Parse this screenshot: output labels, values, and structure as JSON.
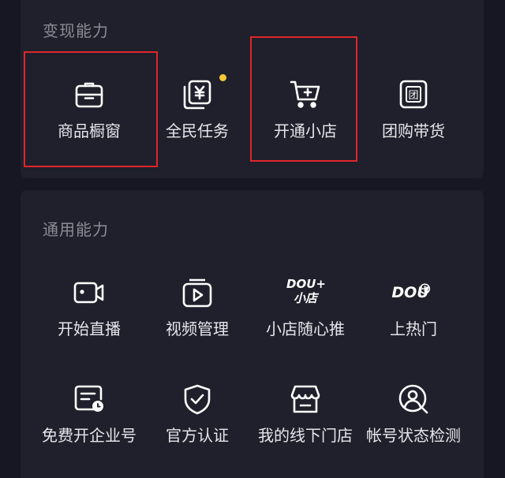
{
  "sections": {
    "monetize": {
      "title": "变现能力",
      "items": [
        {
          "label": "商品橱窗",
          "icon": "briefcase-icon"
        },
        {
          "label": "全民任务",
          "icon": "yen-cards-icon"
        },
        {
          "label": "开通小店",
          "icon": "shopping-cart-icon"
        },
        {
          "label": "团购带货",
          "icon": "group-buy-icon",
          "badge_text": "团"
        }
      ]
    },
    "general": {
      "title": "通用能力",
      "items": [
        {
          "label": "开始直播",
          "icon": "live-camera-icon"
        },
        {
          "label": "视频管理",
          "icon": "video-manage-icon"
        },
        {
          "label": "小店随心推",
          "icon": "dou-plus-shop-logo-icon",
          "logo_line1": "DOU+",
          "logo_line2": "小店"
        },
        {
          "label": "上热门",
          "icon": "dou-plus-logo-icon",
          "logo_text": "DOU"
        },
        {
          "label": "免费开企业号",
          "icon": "enterprise-card-icon"
        },
        {
          "label": "官方认证",
          "icon": "shield-check-icon"
        },
        {
          "label": "我的线下门店",
          "icon": "storefront-icon"
        },
        {
          "label": "帐号状态检测",
          "icon": "account-check-icon"
        }
      ]
    }
  },
  "colors": {
    "background": "#161722",
    "card": "#1f202b",
    "title": "#8b8c95",
    "label": "#e6e6ea",
    "highlight_box": "#e0252b",
    "notification_dot": "#f6c739"
  }
}
